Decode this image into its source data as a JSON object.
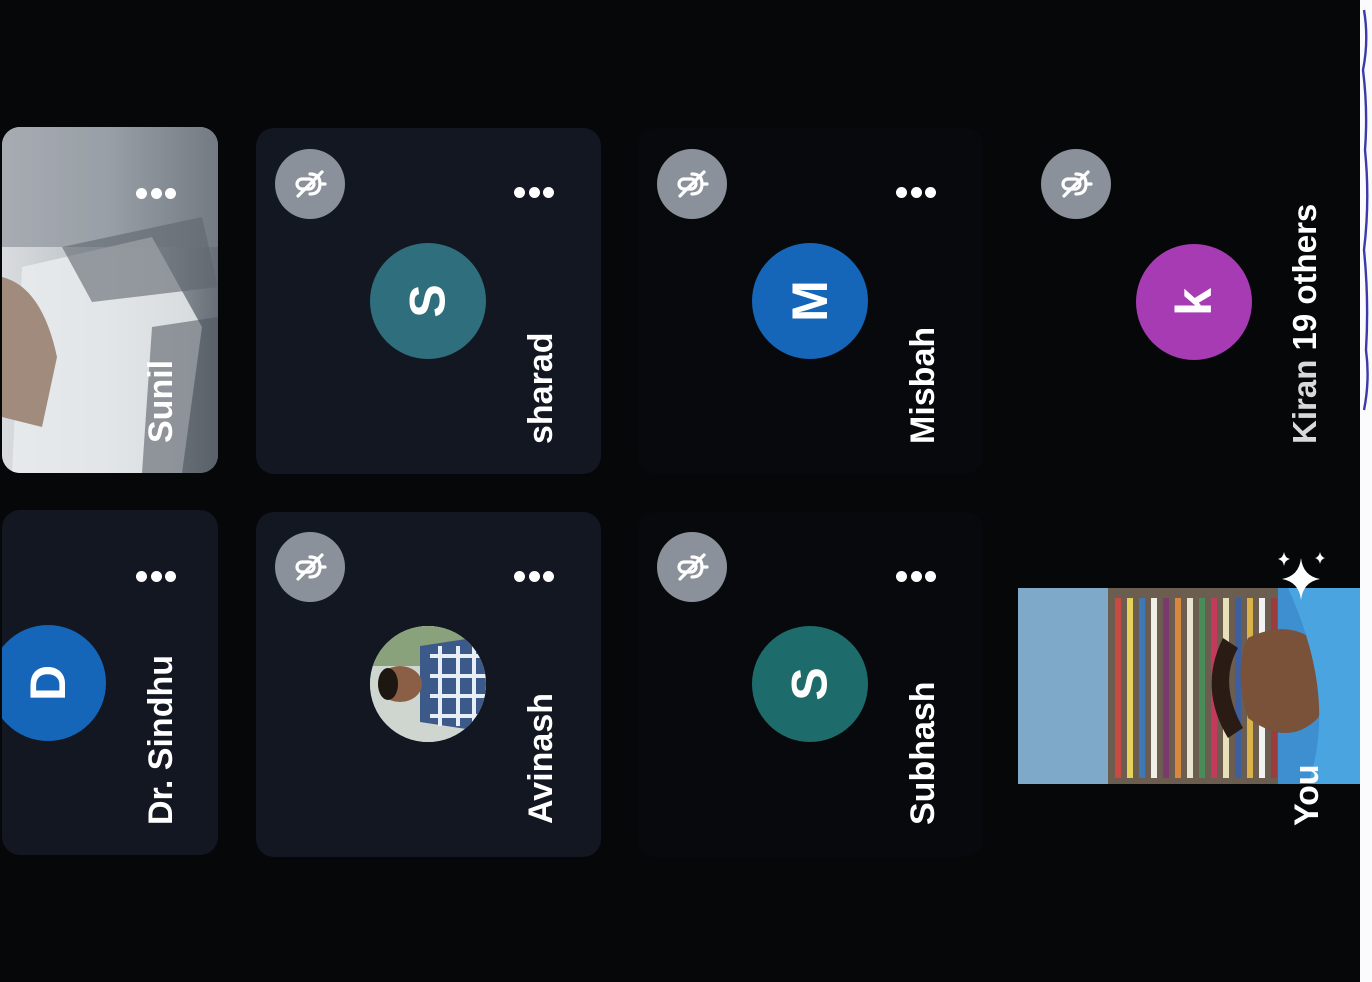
{
  "colors": {
    "screen_background": "#060709",
    "tile_background": "#121722",
    "mic_badge": "#8b919a",
    "avatar_blue": "#1565b8",
    "avatar_teal": "#2f6e7c",
    "avatar_dark_teal": "#1e6b6b",
    "avatar_purple": "#a73bb3"
  },
  "participants": [
    {
      "name": "Dr. Sindhu",
      "avatar_letter": "D",
      "avatar_color": "#1565b8",
      "muted": false,
      "video": false,
      "more_icon": "more-options-icon"
    },
    {
      "name": "Sunil",
      "video": true,
      "muted": false,
      "more_icon": "more-options-icon"
    },
    {
      "name": "Avinash",
      "video": false,
      "has_photo_avatar": true,
      "muted": true,
      "mic_icon": "mic-off-icon",
      "more_icon": "more-options-icon"
    },
    {
      "name": "sharad",
      "avatar_letter": "S",
      "avatar_color": "#2f6e7c",
      "muted": true,
      "mic_icon": "mic-off-icon",
      "more_icon": "more-options-icon"
    },
    {
      "name": "Subhash",
      "avatar_letter": "S",
      "avatar_color": "#1e6b6b",
      "muted": true,
      "mic_icon": "mic-off-icon",
      "more_icon": "more-options-icon"
    },
    {
      "name": "Misbah",
      "avatar_letter": "M",
      "avatar_color": "#1565b8",
      "muted": true,
      "mic_icon": "mic-off-icon",
      "more_icon": "more-options-icon"
    }
  ],
  "self_view": {
    "name": "You",
    "effects_icon": "sparkle-effects-icon"
  },
  "others_tile": {
    "name": "Kiran",
    "others_count_label": "19 others",
    "avatar_letter": "k",
    "avatar_color": "#a73bb3",
    "mic_icon": "mic-off-icon"
  }
}
